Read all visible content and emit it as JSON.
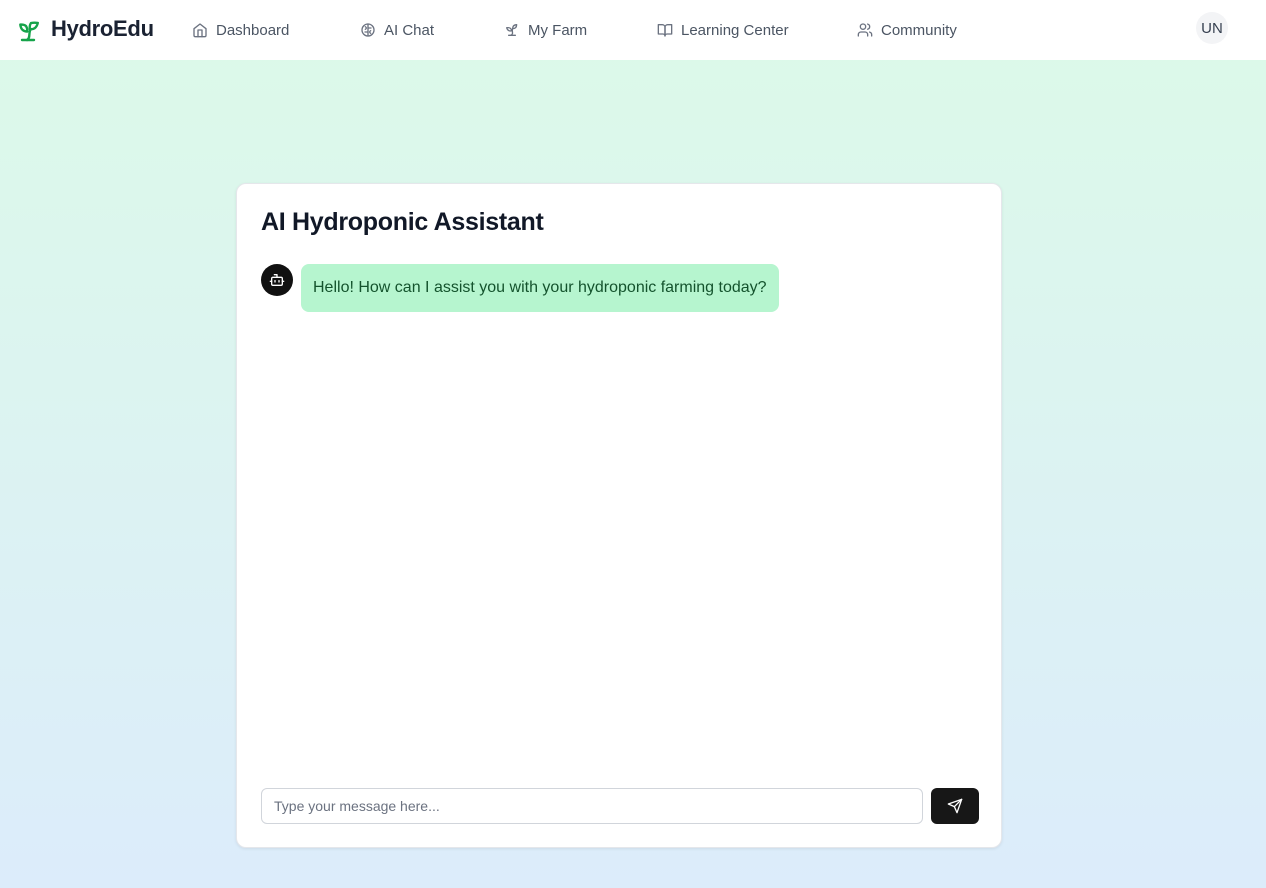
{
  "app": {
    "name": "HydroEdu",
    "logo_icon": "sprout-icon",
    "accent_color": "#16a34a"
  },
  "nav": {
    "items": [
      {
        "label": "Dashboard",
        "icon": "home-icon"
      },
      {
        "label": "AI Chat",
        "icon": "brain-icon"
      },
      {
        "label": "My Farm",
        "icon": "sprout-icon"
      },
      {
        "label": "Learning Center",
        "icon": "book-open-icon"
      },
      {
        "label": "Community",
        "icon": "users-icon"
      }
    ],
    "user_initials": "UN"
  },
  "chat": {
    "title": "AI Hydroponic Assistant",
    "messages": [
      {
        "sender": "bot",
        "avatar_icon": "bot-icon",
        "text": "Hello! How can I assist you with your hydroponic farming today?"
      }
    ],
    "input": {
      "placeholder": "Type your message here...",
      "value": ""
    },
    "send_icon": "send-icon",
    "bubble_color": "#b6f5cf"
  }
}
